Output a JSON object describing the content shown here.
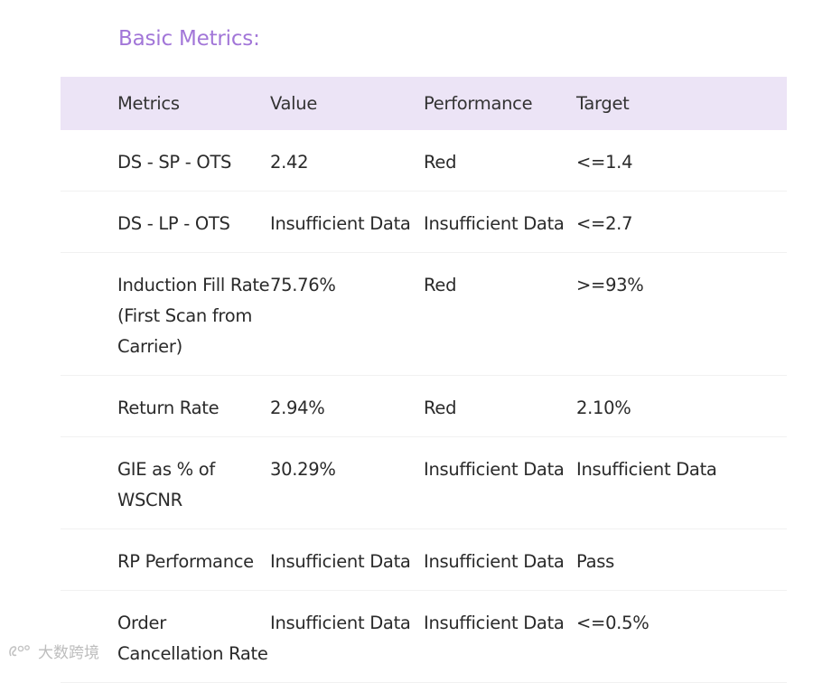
{
  "section": {
    "title": "Basic Metrics:"
  },
  "table": {
    "headers": {
      "metrics": "Metrics",
      "value": "Value",
      "performance": "Performance",
      "target": "Target"
    },
    "rows": [
      {
        "metric": "DS - SP - OTS",
        "value": "2.42",
        "performance": "Red",
        "target": "<=1.4"
      },
      {
        "metric": "DS - LP - OTS",
        "value": "Insufficient Data",
        "performance": "Insufficient Data",
        "target": "<=2.7"
      },
      {
        "metric": "Induction Fill Rate (First Scan from Carrier)",
        "value": "75.76%",
        "performance": "Red",
        "target": ">=93%"
      },
      {
        "metric": "Return Rate",
        "value": "2.94%",
        "performance": "Red",
        "target": "2.10%"
      },
      {
        "metric": "GIE as % of WSCNR",
        "value": "30.29%",
        "performance": "Insufficient Data",
        "target": "Insufficient Data"
      },
      {
        "metric": "RP Performance",
        "value": "Insufficient Data",
        "performance": "Insufficient Data",
        "target": "Pass"
      },
      {
        "metric": "Order Cancellation Rate",
        "value": "Insufficient Data",
        "performance": "Insufficient Data",
        "target": "<=0.5%"
      }
    ]
  },
  "watermark": {
    "text": "大数跨境",
    "icon": "brand-logo-icon"
  }
}
